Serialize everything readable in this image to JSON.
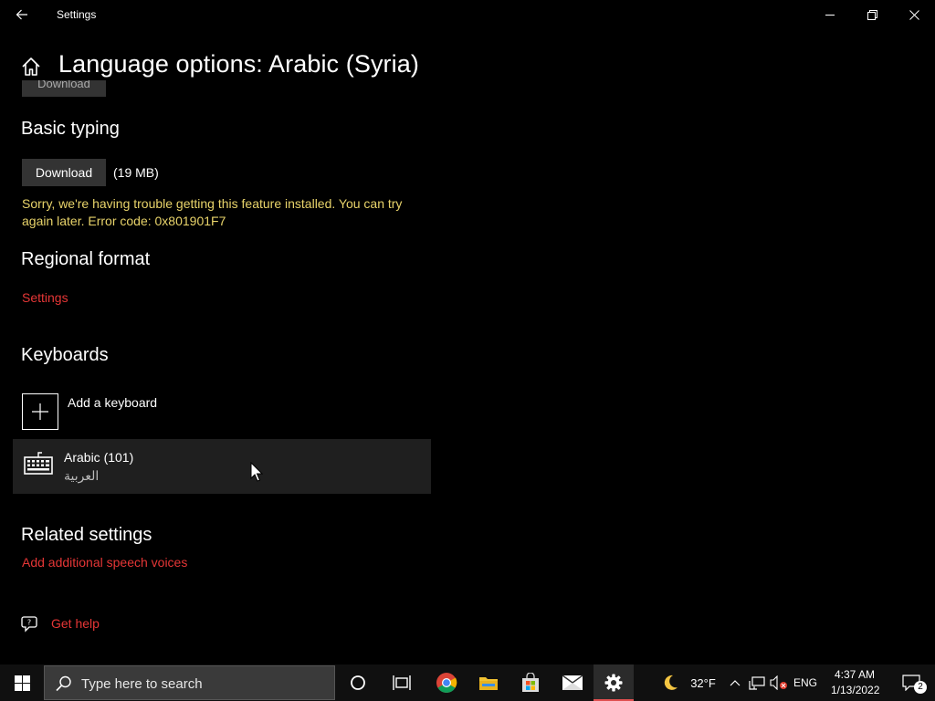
{
  "window": {
    "title": "Settings"
  },
  "page": {
    "title": "Language options: Arabic (Syria)",
    "partial_button_label": "Download"
  },
  "basic_typing": {
    "heading": "Basic typing",
    "download_label": "Download",
    "size": "(19 MB)",
    "error": "Sorry, we're having trouble getting this feature installed. You can try again later. Error code: 0x801901F7"
  },
  "regional_format": {
    "heading": "Regional format",
    "link": "Settings"
  },
  "keyboards": {
    "heading": "Keyboards",
    "add_label": "Add a keyboard",
    "items": [
      {
        "name": "Arabic (101)",
        "native": "العربية"
      }
    ]
  },
  "related": {
    "heading": "Related settings",
    "link": "Add additional speech voices"
  },
  "help": {
    "label": "Get help"
  },
  "taskbar": {
    "search_placeholder": "Type here to search",
    "weather": "32°F",
    "language": "ENG",
    "time": "4:37 AM",
    "date": "1/13/2022",
    "notification_count": "2"
  },
  "colors": {
    "link": "#e53636",
    "error": "#e8d36a",
    "accent": "#e05050"
  }
}
